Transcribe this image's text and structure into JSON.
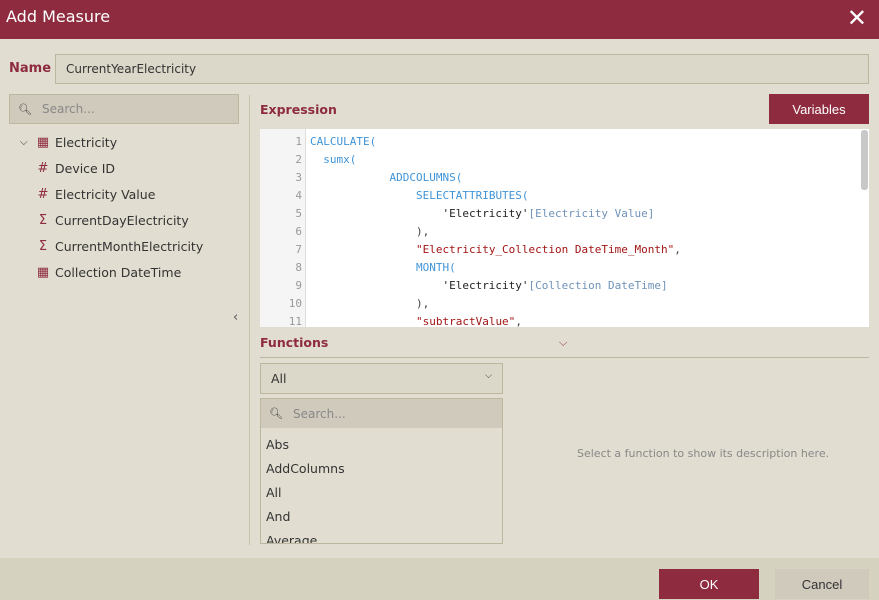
{
  "dialog": {
    "title": "Add Measure",
    "close_icon": "close-icon"
  },
  "name": {
    "label": "Name",
    "value": "CurrentYearElectricity"
  },
  "fields": {
    "search_placeholder": "Search...",
    "table": "Electricity",
    "items": [
      {
        "icon": "hash-icon",
        "glyph": "#",
        "label": "Device ID"
      },
      {
        "icon": "sigma-icon",
        "glyph": "#",
        "label": "Electricity Value"
      },
      {
        "icon": "sigma-icon",
        "glyph": "Σ",
        "label": "CurrentDayElectricity"
      },
      {
        "icon": "sigma-icon",
        "glyph": "Σ",
        "label": "CurrentMonthElectricity"
      },
      {
        "icon": "calendar-icon",
        "glyph": "▦",
        "label": "Collection DateTime"
      }
    ]
  },
  "expression": {
    "label": "Expression",
    "variables_button": "Variables",
    "lines": [
      [
        [
          "CALCULATE(",
          "fn"
        ]
      ],
      [
        [
          "  "
        ],
        [
          "sumx(",
          "fn"
        ]
      ],
      [
        [
          "            "
        ],
        [
          "ADDCOLUMNS(",
          "fn"
        ]
      ],
      [
        [
          "                "
        ],
        [
          "SELECTATTRIBUTES(",
          "fn"
        ]
      ],
      [
        [
          "                    "
        ],
        [
          "'Electricity'",
          "ref"
        ],
        [
          "[Electricity Value]",
          "col"
        ]
      ],
      [
        [
          "                "
        ],
        [
          "),",
          "pun"
        ]
      ],
      [
        [
          "                "
        ],
        [
          "\"Electricity_Collection DateTime_Month\"",
          "str"
        ],
        [
          ",",
          "pun"
        ]
      ],
      [
        [
          "                "
        ],
        [
          "MONTH(",
          "fn"
        ]
      ],
      [
        [
          "                    "
        ],
        [
          "'Electricity'",
          "ref"
        ],
        [
          "[Collection DateTime]",
          "col"
        ]
      ],
      [
        [
          "                "
        ],
        [
          "),",
          "pun"
        ]
      ],
      [
        [
          "                "
        ],
        [
          "\"subtractValue\"",
          "str"
        ],
        [
          ",",
          "pun"
        ]
      ]
    ]
  },
  "functions": {
    "label": "Functions",
    "category": "All",
    "search_placeholder": "Search...",
    "items": [
      "Abs",
      "AddColumns",
      "All",
      "And",
      "Average"
    ],
    "description": "Select a function to show its description here."
  },
  "footer": {
    "ok": "OK",
    "cancel": "Cancel"
  },
  "colors": {
    "accent": "#8e2b3f",
    "background": "#e1ddd0"
  }
}
